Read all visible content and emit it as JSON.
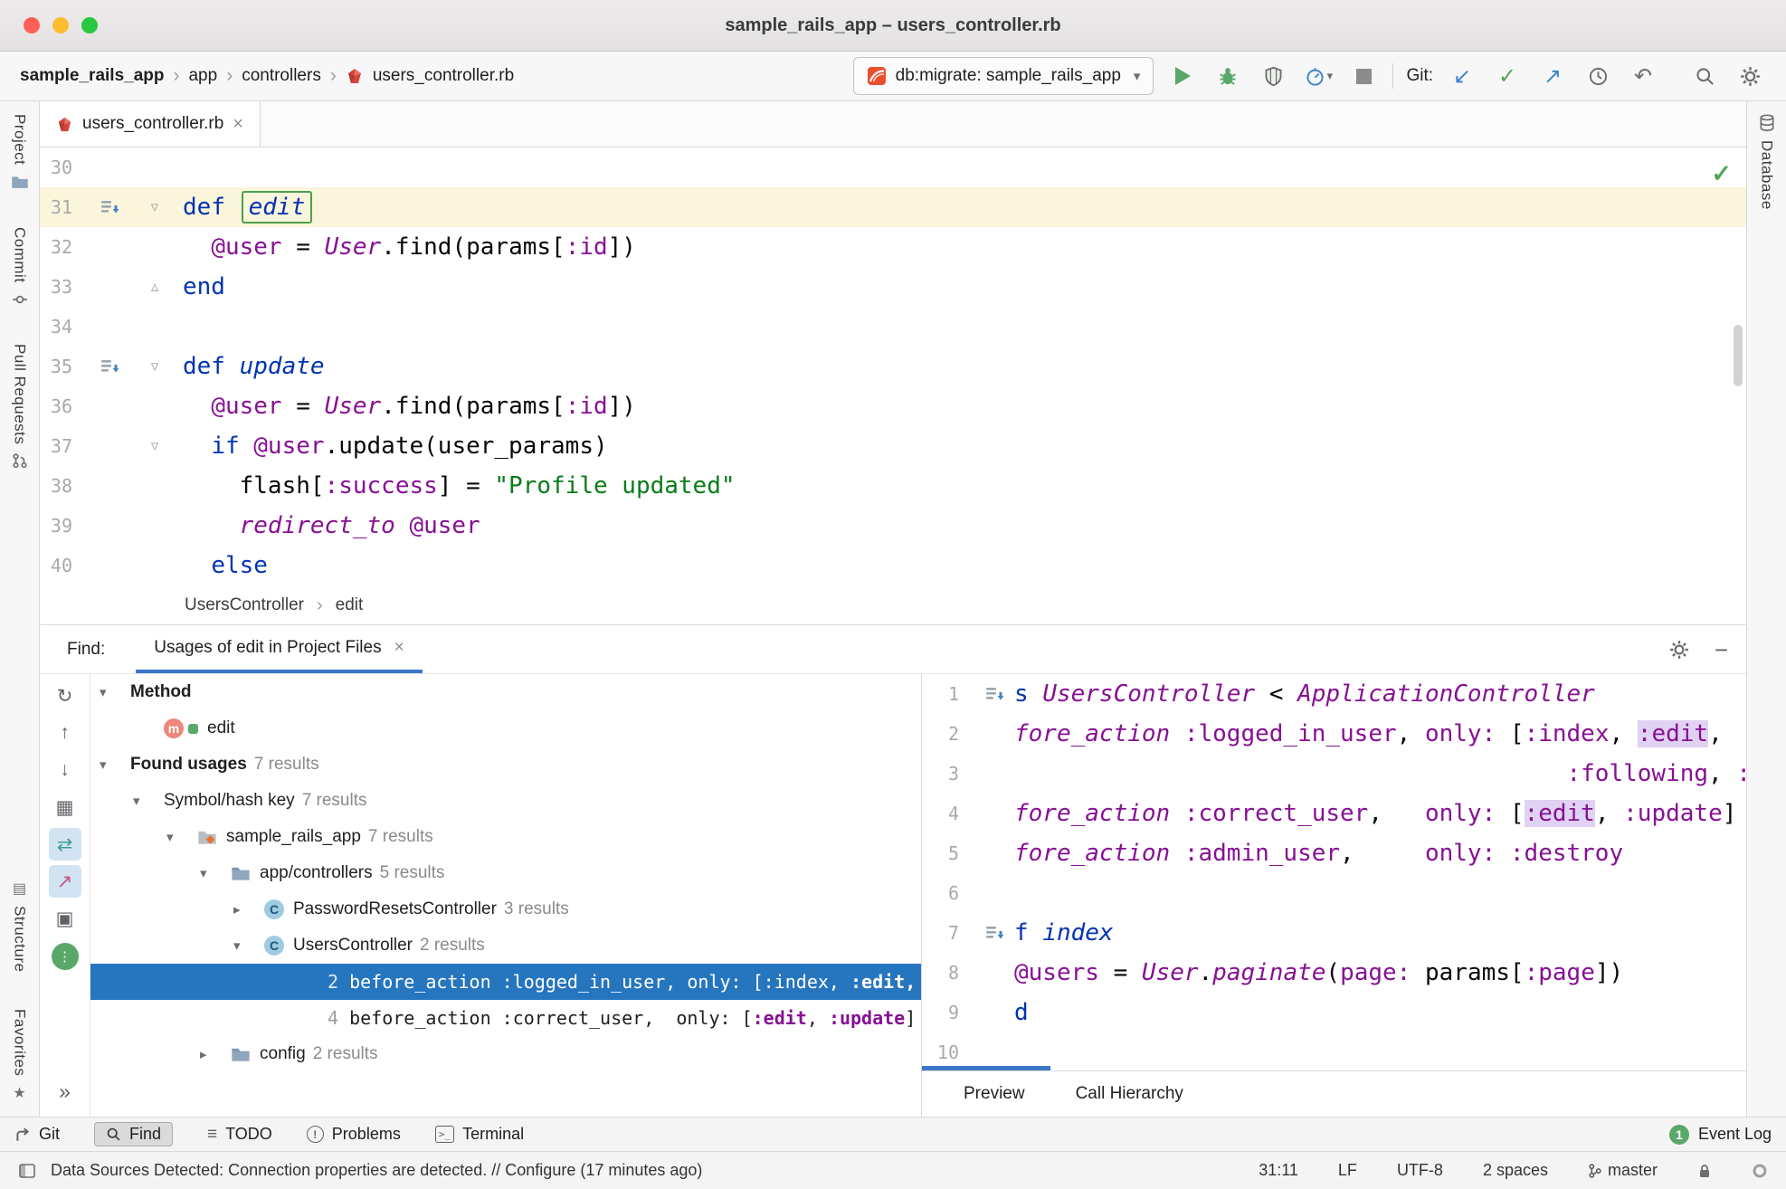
{
  "titlebar": {
    "title": "sample_rails_app – users_controller.rb"
  },
  "glyphs": {
    "close": "×",
    "crumb_sep": "›",
    "dropdown": "▾",
    "minimize": "−",
    "update_arrow": "↙",
    "commit_check": "✓",
    "push_arrow": "↗",
    "rollback": "↶",
    "inspection_check": "✓",
    "todo": "≡",
    "exclaim": "!",
    "terminal_prompt": ">_",
    "structure": "▤",
    "favorites": "★"
  },
  "toolbar": {
    "breadcrumbs": [
      "sample_rails_app",
      "app",
      "controllers",
      "users_controller.rb"
    ],
    "run_config": "db:migrate: sample_rails_app",
    "git_label": "Git:"
  },
  "tabs": {
    "editor_tab": "users_controller.rb"
  },
  "stripes": {
    "left": [
      "Project",
      "Commit",
      "Pull Requests",
      "Structure",
      "Favorites"
    ],
    "right": [
      "Database"
    ]
  },
  "editor": {
    "crumbs": [
      "UsersController",
      "edit"
    ],
    "lines": [
      {
        "num": "30",
        "tokens": []
      },
      {
        "num": "31",
        "current": true,
        "icon": true,
        "fold": "▿",
        "tokens": [
          {
            "t": "def ",
            "s": "kw"
          },
          {
            "t": "edit",
            "s": "decl box"
          }
        ]
      },
      {
        "num": "32",
        "tokens": [
          {
            "t": "  "
          },
          {
            "t": "@user",
            "s": "ivar"
          },
          {
            "t": " = "
          },
          {
            "t": "User",
            "s": "const"
          },
          {
            "t": ".find(params["
          },
          {
            "t": ":id",
            "s": "sym"
          },
          {
            "t": "])"
          }
        ]
      },
      {
        "num": "33",
        "fold": "▵",
        "tokens": [
          {
            "t": "end",
            "s": "kw"
          }
        ]
      },
      {
        "num": "34",
        "tokens": []
      },
      {
        "num": "35",
        "icon": true,
        "fold": "▿",
        "tokens": [
          {
            "t": "def ",
            "s": "kw"
          },
          {
            "t": "update",
            "s": "decl"
          }
        ]
      },
      {
        "num": "36",
        "tokens": [
          {
            "t": "  "
          },
          {
            "t": "@user",
            "s": "ivar"
          },
          {
            "t": " = "
          },
          {
            "t": "User",
            "s": "const"
          },
          {
            "t": ".find(params["
          },
          {
            "t": ":id",
            "s": "sym"
          },
          {
            "t": "])"
          }
        ]
      },
      {
        "num": "37",
        "fold": "▿",
        "tokens": [
          {
            "t": "  "
          },
          {
            "t": "if ",
            "s": "kw"
          },
          {
            "t": "@user",
            "s": "ivar"
          },
          {
            "t": ".update(user_params)"
          }
        ]
      },
      {
        "num": "38",
        "tokens": [
          {
            "t": "    flash["
          },
          {
            "t": ":success",
            "s": "sym"
          },
          {
            "t": "] = "
          },
          {
            "t": "\"Profile updated\"",
            "s": "str"
          }
        ]
      },
      {
        "num": "39",
        "tokens": [
          {
            "t": "    "
          },
          {
            "t": "redirect_to",
            "s": "meth"
          },
          {
            "t": " "
          },
          {
            "t": "@user",
            "s": "ivar"
          }
        ]
      },
      {
        "num": "40",
        "tokens": [
          {
            "t": "  "
          },
          {
            "t": "else",
            "s": "kw"
          }
        ]
      }
    ]
  },
  "find": {
    "label": "Find:",
    "tab": "Usages of edit in Project Files",
    "nav": [
      {
        "name": "rerun-find-icon",
        "glyph": "↻"
      },
      {
        "name": "previous-occurrence-icon",
        "glyph": "↑"
      },
      {
        "name": "next-occurrence-icon",
        "glyph": "↓"
      },
      {
        "name": "group-by-icon",
        "glyph": "▦"
      },
      {
        "name": "expand-all-icon",
        "glyph": "⇄",
        "selected": true,
        "color": "#3E9E8F"
      },
      {
        "name": "autoscroll-to-source-icon",
        "glyph": "↗",
        "selected": true,
        "color": "#C2557E"
      },
      {
        "name": "preview-usages-icon",
        "glyph": "▣"
      },
      {
        "name": "pin-results-icon",
        "glyph": "⋮",
        "round": true
      },
      {
        "name": "more-options-icon",
        "glyph": "»",
        "bottom": true
      }
    ],
    "tree": [
      {
        "name": "tree-node-method",
        "indent": 0,
        "chevron": "down",
        "parts": [
          {
            "t": "Method",
            "s": "b"
          }
        ]
      },
      {
        "name": "tree-node-edit-method",
        "indent": 1,
        "pad": true,
        "icon": "method",
        "parts": [
          {
            "t": "edit"
          }
        ]
      },
      {
        "name": "tree-node-found-usages",
        "indent": 0,
        "chevron": "down",
        "parts": [
          {
            "t": "Found usages",
            "s": "b"
          },
          {
            "t": "7 results",
            "s": "count"
          }
        ]
      },
      {
        "name": "tree-node-symbol-hash-key",
        "indent": 1,
        "chevron": "down",
        "parts": [
          {
            "t": "Symbol/hash key"
          },
          {
            "t": "7 results",
            "s": "count"
          }
        ]
      },
      {
        "name": "tree-node-sample-rails-app",
        "indent": 2,
        "chevron": "down",
        "icon": "project",
        "parts": [
          {
            "t": "sample_rails_app"
          },
          {
            "t": "7 results",
            "s": "count"
          }
        ]
      },
      {
        "name": "tree-node-app-controllers",
        "indent": 3,
        "chevron": "down",
        "icon": "folder",
        "parts": [
          {
            "t": "app/controllers"
          },
          {
            "t": "5 results",
            "s": "count"
          }
        ]
      },
      {
        "name": "tree-node-password-resets-controller",
        "indent": 4,
        "chevron": "right",
        "icon": "class",
        "parts": [
          {
            "t": "PasswordResetsController"
          },
          {
            "t": "3 results",
            "s": "count"
          }
        ]
      },
      {
        "name": "tree-node-users-controller",
        "indent": 4,
        "chevron": "down",
        "icon": "class",
        "parts": [
          {
            "t": "UsersController"
          },
          {
            "t": "2 results",
            "s": "count"
          }
        ]
      },
      {
        "name": "usage-result-line2",
        "indent": 6.8,
        "selected": true,
        "parts": [
          {
            "t": "2 ",
            "s": "mono num"
          },
          {
            "t": "before_action :logged_in_user, only: [:index, ",
            "s": "mono"
          },
          {
            "t": ":edit,",
            "s": "mono b"
          }
        ]
      },
      {
        "name": "usage-result-line4",
        "indent": 6.8,
        "parts": [
          {
            "t": "4 ",
            "s": "mono num"
          },
          {
            "t": "before_action :correct_user,  only: [",
            "s": "mono"
          },
          {
            "t": ":edit",
            "s": "mono symb"
          },
          {
            "t": ", ",
            "s": "mono"
          },
          {
            "t": ":update",
            "s": "mono symb"
          },
          {
            "t": "]",
            "s": "mono"
          }
        ]
      },
      {
        "name": "tree-node-config",
        "indent": 3,
        "chevron": "right",
        "icon": "folder",
        "parts": [
          {
            "t": "config"
          },
          {
            "t": "2 results",
            "s": "count"
          }
        ]
      }
    ]
  },
  "preview": {
    "tabs": [
      "Preview",
      "Call Hierarchy"
    ],
    "lines": [
      {
        "num": "1",
        "icon": true,
        "tokens": [
          {
            "t": "s ",
            "s": "kw"
          },
          {
            "t": "UsersController",
            "s": "const"
          },
          {
            "t": " < "
          },
          {
            "t": "ApplicationController",
            "s": "const"
          }
        ]
      },
      {
        "num": "2",
        "tokens": [
          {
            "t": "fore_action ",
            "s": "meth"
          },
          {
            "t": ":logged_in_user",
            "s": "sym"
          },
          {
            "t": ", "
          },
          {
            "t": "only:",
            "s": "sym"
          },
          {
            "t": " ["
          },
          {
            "t": ":index",
            "s": "sym"
          },
          {
            "t": ", "
          },
          {
            "t": ":edit",
            "s": "sym hl"
          },
          {
            "t": ","
          }
        ]
      },
      {
        "num": "3",
        "tokens": [
          {
            "pad": 39
          },
          {
            "t": ":following",
            "s": "sym"
          },
          {
            "t": ", "
          },
          {
            "t": ":fo",
            "s": "sym"
          }
        ]
      },
      {
        "num": "4",
        "tokens": [
          {
            "t": "fore_action ",
            "s": "meth"
          },
          {
            "t": ":correct_user",
            "s": "sym"
          },
          {
            "t": ",   "
          },
          {
            "t": "only:",
            "s": "sym"
          },
          {
            "t": " ["
          },
          {
            "t": ":edit",
            "s": "sym hl"
          },
          {
            "t": ", "
          },
          {
            "t": ":update",
            "s": "sym"
          },
          {
            "t": "]"
          }
        ]
      },
      {
        "num": "5",
        "tokens": [
          {
            "t": "fore_action ",
            "s": "meth"
          },
          {
            "t": ":admin_user",
            "s": "sym"
          },
          {
            "t": ",     "
          },
          {
            "t": "only:",
            "s": "sym"
          },
          {
            "t": " "
          },
          {
            "t": ":destroy",
            "s": "sym"
          }
        ]
      },
      {
        "num": "6",
        "tokens": []
      },
      {
        "num": "7",
        "icon": true,
        "tokens": [
          {
            "t": "f ",
            "s": "kw"
          },
          {
            "t": "index",
            "s": "decl"
          }
        ]
      },
      {
        "num": "8",
        "tokens": [
          {
            "t": "@users",
            "s": "ivar"
          },
          {
            "t": " = "
          },
          {
            "t": "User",
            "s": "const"
          },
          {
            "t": "."
          },
          {
            "t": "paginate",
            "s": "meth"
          },
          {
            "t": "("
          },
          {
            "t": "page:",
            "s": "sym"
          },
          {
            "t": " params["
          },
          {
            "t": ":page",
            "s": "sym"
          },
          {
            "t": "])"
          }
        ]
      },
      {
        "num": "9",
        "tokens": [
          {
            "t": "d",
            "s": "kw"
          }
        ]
      },
      {
        "num": "10",
        "tokens": []
      }
    ]
  },
  "bottombar": {
    "items": [
      "Git",
      "Find",
      "TODO",
      "Problems",
      "Terminal"
    ],
    "event_log": "Event Log",
    "badge": "1"
  },
  "statusbar": {
    "message": "Data Sources Detected: Connection properties are detected. // Configure (17 minutes ago)",
    "caret": "31:11",
    "line_sep": "LF",
    "encoding": "UTF-8",
    "indent": "2 spaces",
    "branch": "master"
  }
}
